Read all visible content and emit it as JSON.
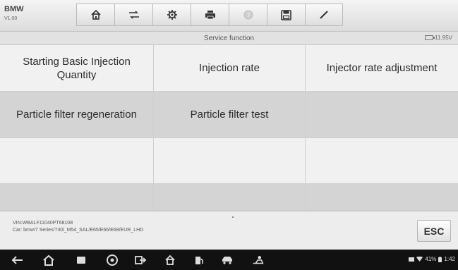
{
  "header": {
    "app_name": "BMW",
    "version": "V1.00",
    "toolbar": [
      {
        "name": "home-icon",
        "state": "normal"
      },
      {
        "name": "vehicle-swap-icon",
        "state": "normal"
      },
      {
        "name": "settings-gear-icon",
        "state": "normal"
      },
      {
        "name": "print-icon",
        "state": "normal"
      },
      {
        "name": "help-icon",
        "state": "disabled"
      },
      {
        "name": "save-icon",
        "state": "normal"
      },
      {
        "name": "data-logging-icon",
        "state": "normal"
      }
    ]
  },
  "subbar": {
    "title": "Service function",
    "voltage": "11.95V"
  },
  "functions": {
    "rows": [
      [
        "Starting Basic Injection Quantity",
        "Injection rate",
        "Injector rate adjustment"
      ],
      [
        "Particle filter regeneration",
        "Particle filter test",
        ""
      ],
      [
        "",
        "",
        ""
      ],
      [
        "",
        "",
        ""
      ]
    ]
  },
  "footer": {
    "vin": "VIN:WBALF11040PT68108",
    "car": "Car: bmw/7 Series/730i_M54_SAL/E65/E66/E68/EUR_LHD",
    "esc_label": "ESC"
  },
  "navbar": {
    "battery_percent": "41%",
    "time": "1:42"
  },
  "colors": {
    "row_light": "#f1f1f1",
    "row_dark": "#d4d4d4",
    "navbar": "#111111"
  }
}
